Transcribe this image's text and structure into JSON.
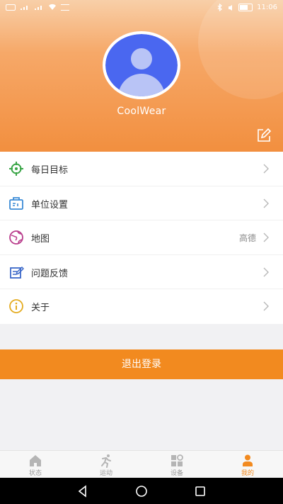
{
  "status_bar": {
    "left_indicators": [
      "volte-icon",
      "signal-icon",
      "signal-icon",
      "wifi-icon",
      "speed-icon"
    ],
    "right_indicators": [
      "bluetooth-icon",
      "mute-icon",
      "battery-icon"
    ],
    "time": "11:06"
  },
  "profile": {
    "username": "CoolWear",
    "avatar_icon": "person-avatar-icon",
    "edit_icon": "edit-icon"
  },
  "menu": {
    "items": [
      {
        "label": "每日目标",
        "value": "",
        "icon": "target-icon"
      },
      {
        "label": "单位设置",
        "value": "",
        "icon": "unit-settings-icon"
      },
      {
        "label": "地图",
        "value": "高德",
        "icon": "map-globe-icon"
      },
      {
        "label": "问题反馈",
        "value": "",
        "icon": "feedback-icon"
      },
      {
        "label": "关于",
        "value": "",
        "icon": "info-icon"
      }
    ]
  },
  "logout": {
    "label": "退出登录"
  },
  "tabs": [
    {
      "label": "状态",
      "icon": "home-icon",
      "active": false
    },
    {
      "label": "运动",
      "icon": "running-icon",
      "active": false
    },
    {
      "label": "设备",
      "icon": "device-grid-icon",
      "active": false
    },
    {
      "label": "我的",
      "icon": "profile-icon",
      "active": true
    }
  ],
  "colors": {
    "accent": "#f28a1f",
    "header_gradient_top": "#f8cfa8",
    "header_gradient_bottom": "#f28f3f",
    "avatar_bg": "#4a67f0",
    "text_primary": "#333333",
    "text_secondary": "#8a8a8a"
  }
}
